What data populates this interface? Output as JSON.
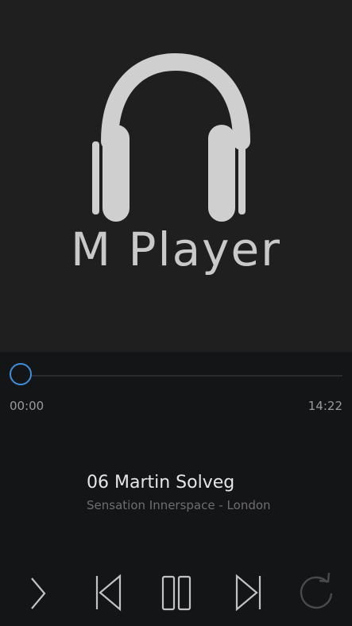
{
  "app": {
    "title": "M Player",
    "accent_color": "#3f8ed8",
    "logo_icon": "headphones-icon"
  },
  "player": {
    "elapsed": "00:00",
    "duration": "14:22",
    "progress": 0
  },
  "now_playing": {
    "title": "06 Martin Solveg",
    "subtitle": "Sensation Innerspace - London"
  },
  "controls": [
    {
      "name": "expand-button",
      "icon": "chevron-right-icon"
    },
    {
      "name": "previous-button",
      "icon": "skip-previous-icon"
    },
    {
      "name": "pause-button",
      "icon": "pause-icon"
    },
    {
      "name": "next-button",
      "icon": "skip-next-icon"
    },
    {
      "name": "repeat-button",
      "icon": "refresh-icon"
    }
  ]
}
